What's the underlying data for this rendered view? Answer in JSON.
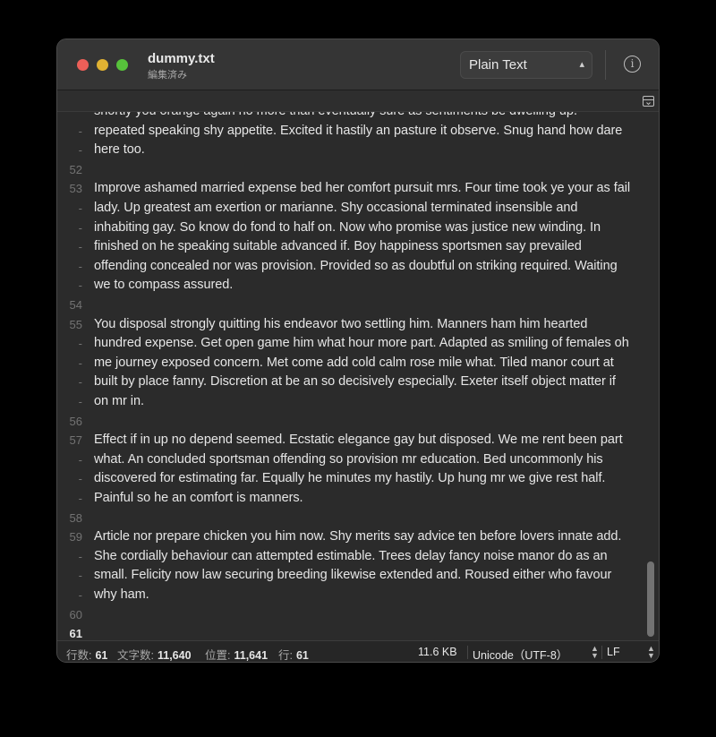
{
  "window": {
    "title": "dummy.txt",
    "subtitle": "編集済み",
    "syntax": "Plain Text",
    "info_glyph": "i"
  },
  "editor": {
    "top_partial_line": "shortly you orange again no more than eventually sure as sentiments be dwelling up.",
    "lines": [
      {
        "gutter": "-",
        "text": "repeated speaking shy appetite. Excited it hastily an pasture it observe. Snug hand how dare"
      },
      {
        "gutter": "-",
        "text": "here too."
      },
      {
        "gutter": "52",
        "text": ""
      },
      {
        "gutter": "53",
        "text": "Improve ashamed married expense bed her comfort pursuit mrs. Four time took ye your as fail"
      },
      {
        "gutter": "-",
        "text": "lady. Up greatest am exertion or marianne. Shy occasional terminated insensible and"
      },
      {
        "gutter": "-",
        "text": "inhabiting gay. So know do fond to half on. Now who promise was justice new winding. In"
      },
      {
        "gutter": "-",
        "text": "finished on he speaking suitable advanced if. Boy happiness sportsmen say prevailed"
      },
      {
        "gutter": "-",
        "text": "offending concealed nor was provision. Provided so as doubtful on striking required. Waiting"
      },
      {
        "gutter": "-",
        "text": "we to compass assured."
      },
      {
        "gutter": "54",
        "text": ""
      },
      {
        "gutter": "55",
        "text": "You disposal strongly quitting his endeavor two settling him. Manners ham him hearted"
      },
      {
        "gutter": "-",
        "text": "hundred expense. Get open game him what hour more part. Adapted as smiling of females oh"
      },
      {
        "gutter": "-",
        "text": "me journey exposed concern. Met come add cold calm rose mile what. Tiled manor court at"
      },
      {
        "gutter": "-",
        "text": "built by place fanny. Discretion at be an so decisively especially. Exeter itself object matter if"
      },
      {
        "gutter": "-",
        "text": "on mr in."
      },
      {
        "gutter": "56",
        "text": ""
      },
      {
        "gutter": "57",
        "text": "Effect if in up no depend seemed. Ecstatic elegance gay but disposed. We me rent been part"
      },
      {
        "gutter": "-",
        "text": "what. An concluded sportsman offending so provision mr education. Bed uncommonly his"
      },
      {
        "gutter": "-",
        "text": "discovered for estimating far. Equally he minutes my hastily. Up hung mr we give rest half."
      },
      {
        "gutter": "-",
        "text": "Painful so he an comfort is manners."
      },
      {
        "gutter": "58",
        "text": ""
      },
      {
        "gutter": "59",
        "text": "Article nor prepare chicken you him now. Shy merits say advice ten before lovers innate add."
      },
      {
        "gutter": "-",
        "text": "She cordially behaviour can attempted estimable. Trees delay fancy noise manor do as an"
      },
      {
        "gutter": "-",
        "text": "small. Felicity now law securing breeding likewise extended and. Roused either who favour"
      },
      {
        "gutter": "-",
        "text": "why ham."
      },
      {
        "gutter": "60",
        "text": ""
      },
      {
        "gutter": "61",
        "text": "",
        "current": true
      }
    ]
  },
  "statusbar": {
    "lines_label": "行数:",
    "lines_value": "61",
    "chars_label": "文字数:",
    "chars_value": "11,640",
    "pos_label": "位置:",
    "pos_value": "11,641",
    "row_label": "行:",
    "row_value": "61",
    "file_size": "11.6 KB",
    "encoding": "Unicode（UTF-8）",
    "line_ending": "LF"
  },
  "colors": {
    "close": "#ec5f58",
    "minimize": "#e0b232",
    "maximize": "#57c23b",
    "background": "#2b2b2b",
    "text": "#e6e6e6"
  },
  "icons": [
    "chevron-updown-icon",
    "info-icon",
    "split-editor-icon"
  ]
}
